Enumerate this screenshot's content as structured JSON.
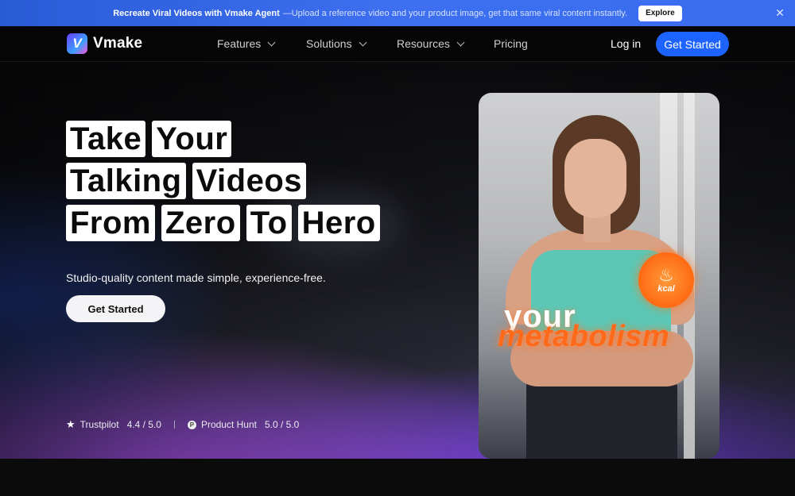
{
  "announcement": {
    "title": "Recreate Viral Videos with Vmake Agent",
    "text": " —Upload a reference video and your product image, get that same viral content instantly.",
    "button": "Explore"
  },
  "nav": {
    "logo_letter": "V",
    "brand": "Vmake",
    "items": [
      {
        "label": "Features"
      },
      {
        "label": "Solutions"
      },
      {
        "label": "Resources"
      },
      {
        "label": "Pricing"
      }
    ],
    "login": "Log in",
    "cta": "Get Started"
  },
  "hero": {
    "headline_rows": [
      [
        "Take",
        "Your"
      ],
      [
        "Talking",
        "Videos"
      ],
      [
        "From",
        "Zero",
        "To",
        "Hero"
      ]
    ],
    "subtitle": "Studio-quality content made simple, experience-free.",
    "cta": "Get Started",
    "ratings": {
      "trustpilot_label": "Trustpilot",
      "trustpilot_score": "4.4 / 5.0",
      "producthunt_icon": "P",
      "producthunt_label": "Product Hunt",
      "producthunt_score": "5.0 / 5.0"
    }
  },
  "video": {
    "badge_text": "kcal",
    "caption_line1": "your",
    "caption_line2": "metabolism"
  },
  "colors": {
    "accent": "#1d63ff",
    "announcement_bg": "#3d6ff0",
    "caption_orange": "#ff6a1a"
  }
}
